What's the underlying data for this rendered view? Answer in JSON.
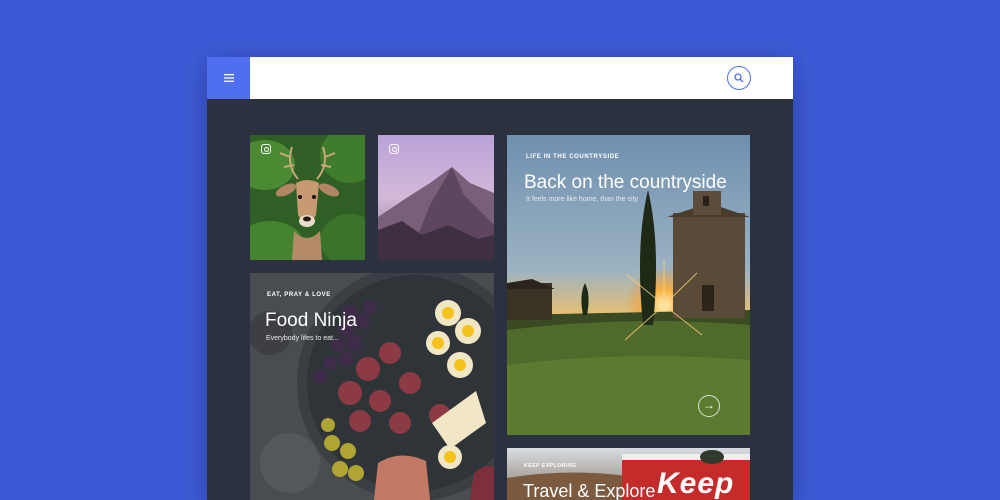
{
  "topbar": {
    "menu_icon": "hamburger-menu-icon",
    "search_icon": "search-icon"
  },
  "tiles": {
    "deer": {
      "icon": "instagram-icon"
    },
    "mountain": {
      "icon": "instagram-icon"
    },
    "countryside": {
      "kicker": "LIFE IN THE COUNTRYSIDE",
      "title": "Back on the countryside",
      "subtitle": "It feels more like home, than the city",
      "action_icon": "arrow-right-icon"
    },
    "food": {
      "kicker": "EAT, PRAY & LOVE",
      "title": "Food Ninja",
      "subtitle": "Everybody lifes to eat..."
    },
    "travel": {
      "kicker": "KEEP EXPLORING",
      "title": "Travel & Explore",
      "sign_text": "Keep"
    }
  },
  "colors": {
    "background": "#3d5ad6",
    "accent": "#4f6ef0",
    "panel": "#2c3140"
  }
}
